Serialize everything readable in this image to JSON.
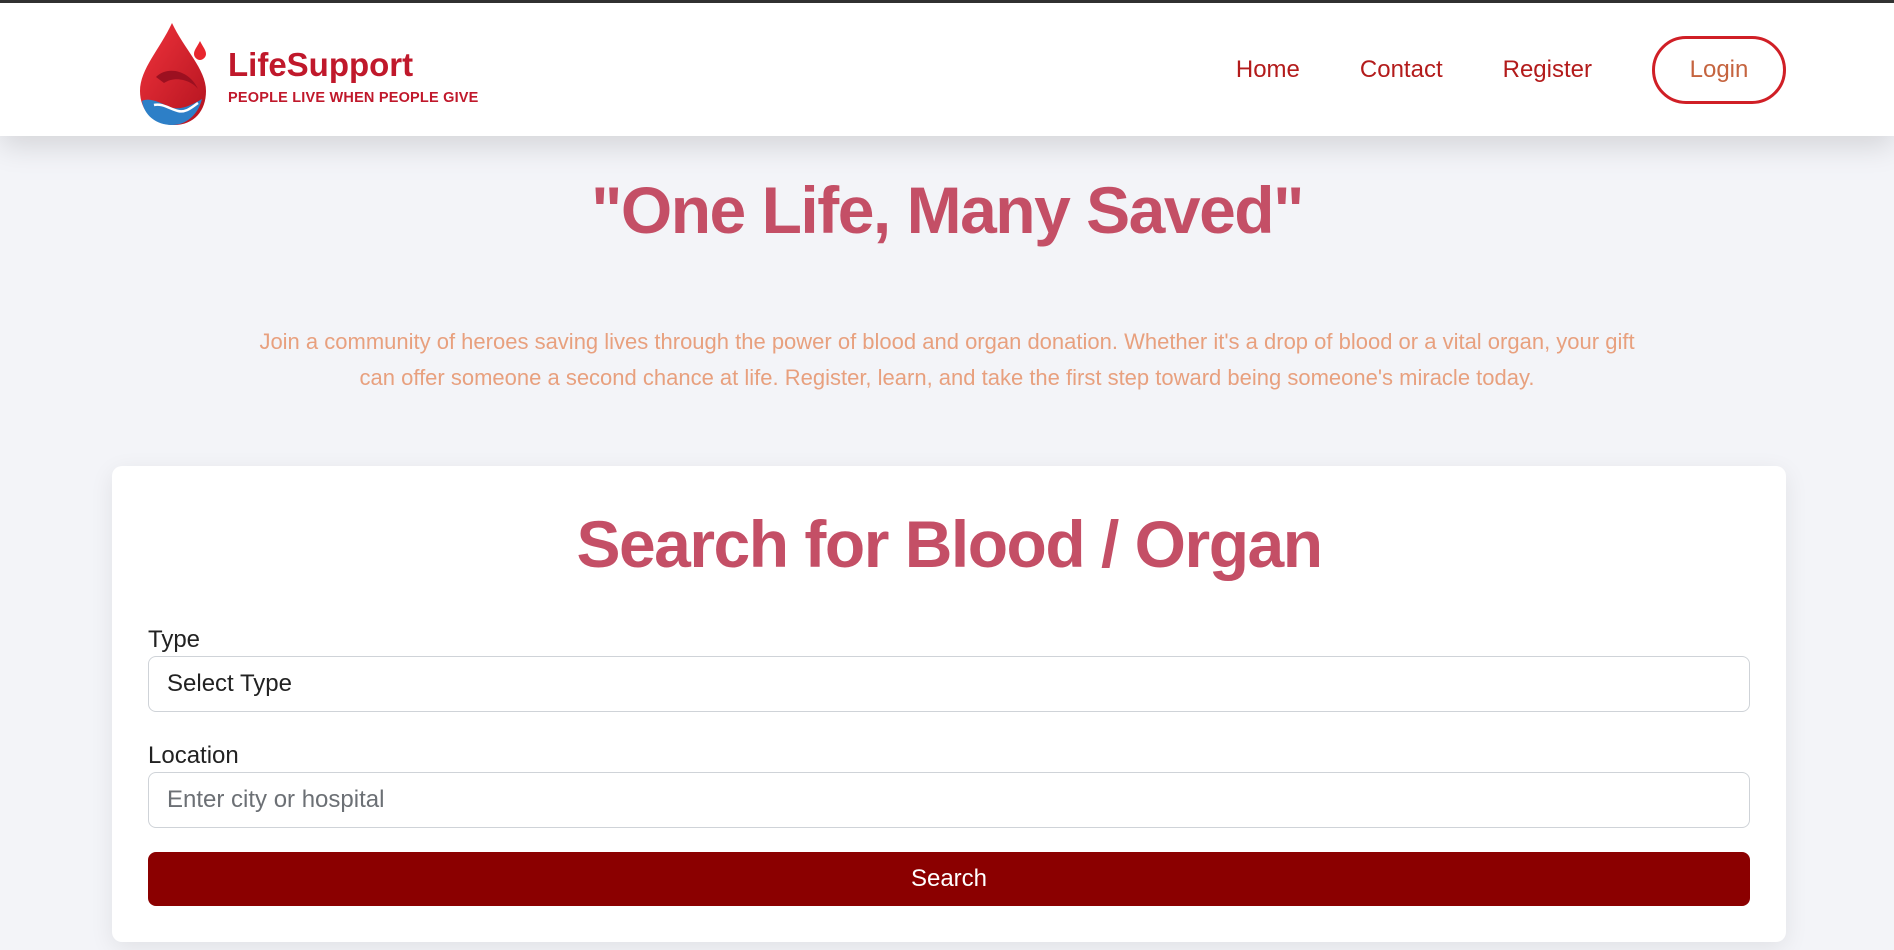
{
  "brand": {
    "name": "LifeSupport",
    "tagline": "PEOPLE LIVE WHEN PEOPLE GIVE",
    "logo_icon": "blood-drop-hands-icon"
  },
  "nav": {
    "home": "Home",
    "contact": "Contact",
    "register": "Register",
    "login": "Login"
  },
  "hero": {
    "title": "\"One Life, Many Saved\"",
    "description": "Join a community of heroes saving lives through the power of blood and organ donation. Whether it's a drop of blood or a vital organ, your gift can offer someone a second chance at life. Register, learn, and take the first step toward being someone's miracle today."
  },
  "search": {
    "title": "Search for Blood / Organ",
    "type_label": "Type",
    "type_value": "Select Type",
    "location_label": "Location",
    "location_placeholder": "Enter city or hospital",
    "button_label": "Search"
  },
  "colors": {
    "brand_red": "#c0182b",
    "heading_rose": "#c44f66",
    "description_orange": "#e8a07e",
    "button_dark_red": "#8b0000",
    "login_border": "#d01f26"
  }
}
